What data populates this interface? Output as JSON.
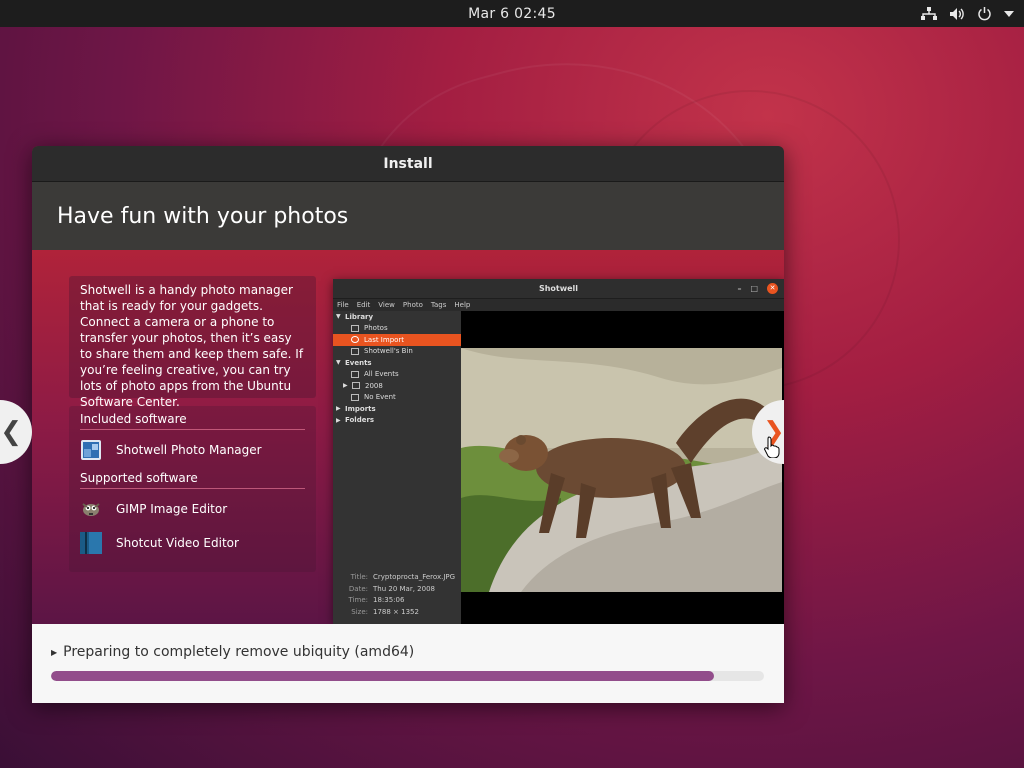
{
  "topbar": {
    "clock": "Mar 6  02:45",
    "icons": [
      "network-icon",
      "volume-icon",
      "power-icon",
      "menu-arrow-icon"
    ]
  },
  "window": {
    "title": "Install",
    "header": "Have fun with your photos"
  },
  "slide": {
    "description": "Shotwell is a handy photo manager that is ready for your gadgets. Connect a camera or a phone to transfer your photos, then it’s easy to share them and keep them safe. If you’re feeling creative, you can try lots of photo apps from the Ubuntu Software Center.",
    "included_heading": "Included software",
    "included": [
      {
        "label": "Shotwell Photo Manager",
        "icon": "shotwell-icon"
      }
    ],
    "supported_heading": "Supported software",
    "supported": [
      {
        "label": "GIMP Image Editor",
        "icon": "gimp-icon"
      },
      {
        "label": "Shotcut Video Editor",
        "icon": "shotcut-icon"
      }
    ],
    "prev_label": "❮",
    "next_label": "❯"
  },
  "shotwell": {
    "title": "Shotwell",
    "menu": [
      "File",
      "Edit",
      "View",
      "Photo",
      "Tags",
      "Help"
    ],
    "sidebar": {
      "library": "Library",
      "photos": "Photos",
      "last_import": "Last Import",
      "bin": "Shotwell's Bin",
      "events": "Events",
      "all_events": "All Events",
      "year": "2008",
      "no_event": "No Event",
      "imports": "Imports",
      "folders": "Folders"
    },
    "meta": [
      {
        "key": "Title:",
        "value": "Cryptoprocta_Ferox.JPG"
      },
      {
        "key": "Date:",
        "value": "Thu 20 Mar, 2008"
      },
      {
        "key": "Time:",
        "value": "18:35:06"
      },
      {
        "key": "Size:",
        "value": "1788 × 1352"
      }
    ]
  },
  "progress": {
    "status": "Preparing to completely remove ubiquity (amd64)",
    "fraction": 0.93
  }
}
